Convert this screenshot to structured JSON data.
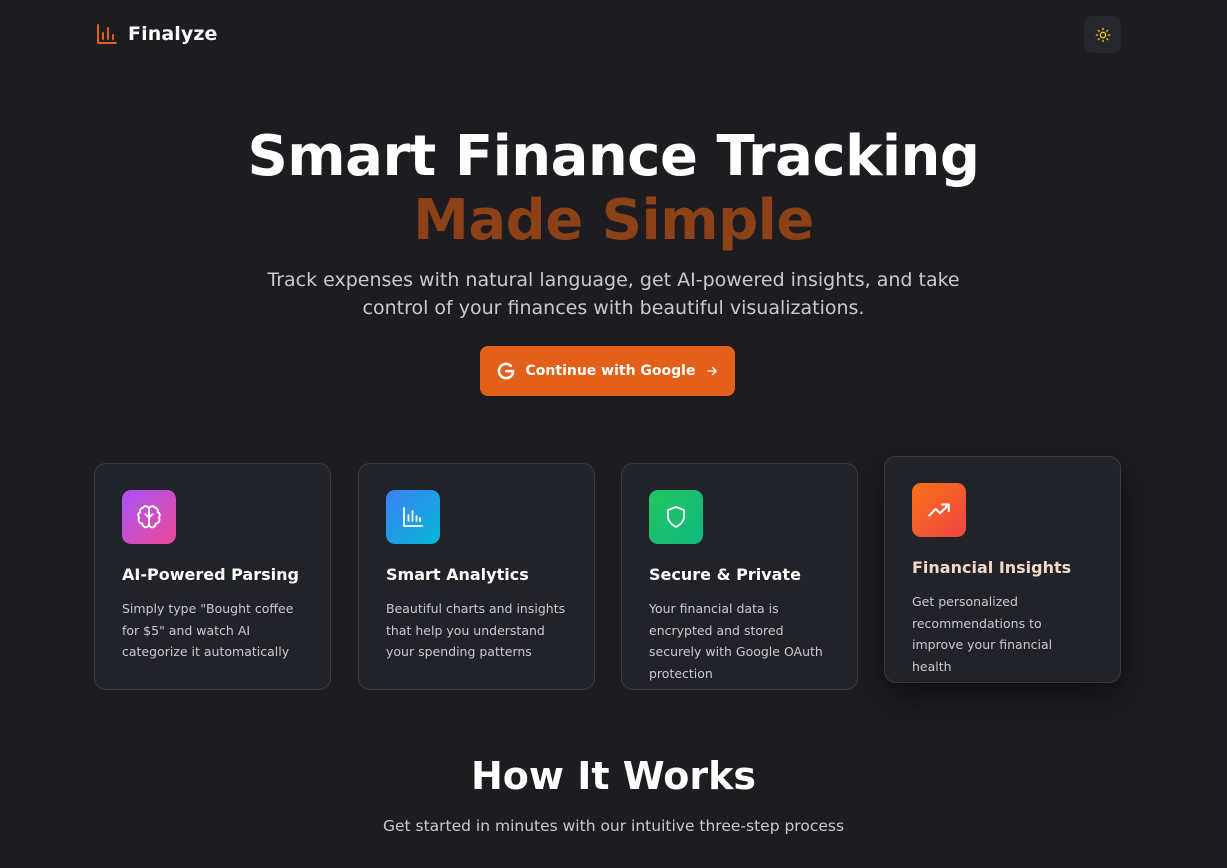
{
  "brand": {
    "name": "Finalyze",
    "accent_color": "#e2601a",
    "logo_icon": "bar-chart-icon"
  },
  "header": {
    "theme_toggle_icon": "sun-icon"
  },
  "hero": {
    "title": "Smart Finance Tracking",
    "title_accent": "Made Simple",
    "accent_text_color": "#8c4116",
    "subtitle": "Track expenses with natural language, get AI-powered insights, and take control of your finances with beautiful visualizations.",
    "cta_label": "Continue with Google",
    "cta_icon": "google-icon",
    "cta_arrow_icon": "arrow-right-icon"
  },
  "features": [
    {
      "title": "AI-Powered Parsing",
      "text": "Simply type \"Bought coffee for $5\" and watch AI categorize it automatically",
      "icon": "brain-icon",
      "gradient": [
        "#a855f7",
        "#ec4899"
      ]
    },
    {
      "title": "Smart Analytics",
      "text": "Beautiful charts and insights that help you understand your spending patterns",
      "icon": "bar-chart-icon",
      "gradient": [
        "#3b82f6",
        "#06b6d4"
      ]
    },
    {
      "title": "Secure & Private",
      "text": "Your financial data is encrypted and stored securely with Google OAuth protection",
      "icon": "shield-icon",
      "gradient": [
        "#22c55e",
        "#10b981"
      ]
    },
    {
      "title": "Financial Insights",
      "text": "Get personalized recommendations to improve your financial health",
      "icon": "trending-up-icon",
      "gradient": [
        "#f97316",
        "#ef4444"
      ]
    }
  ],
  "how_it_works": {
    "title": "How It Works",
    "subtitle": "Get started in minutes with our intuitive three-step process"
  }
}
